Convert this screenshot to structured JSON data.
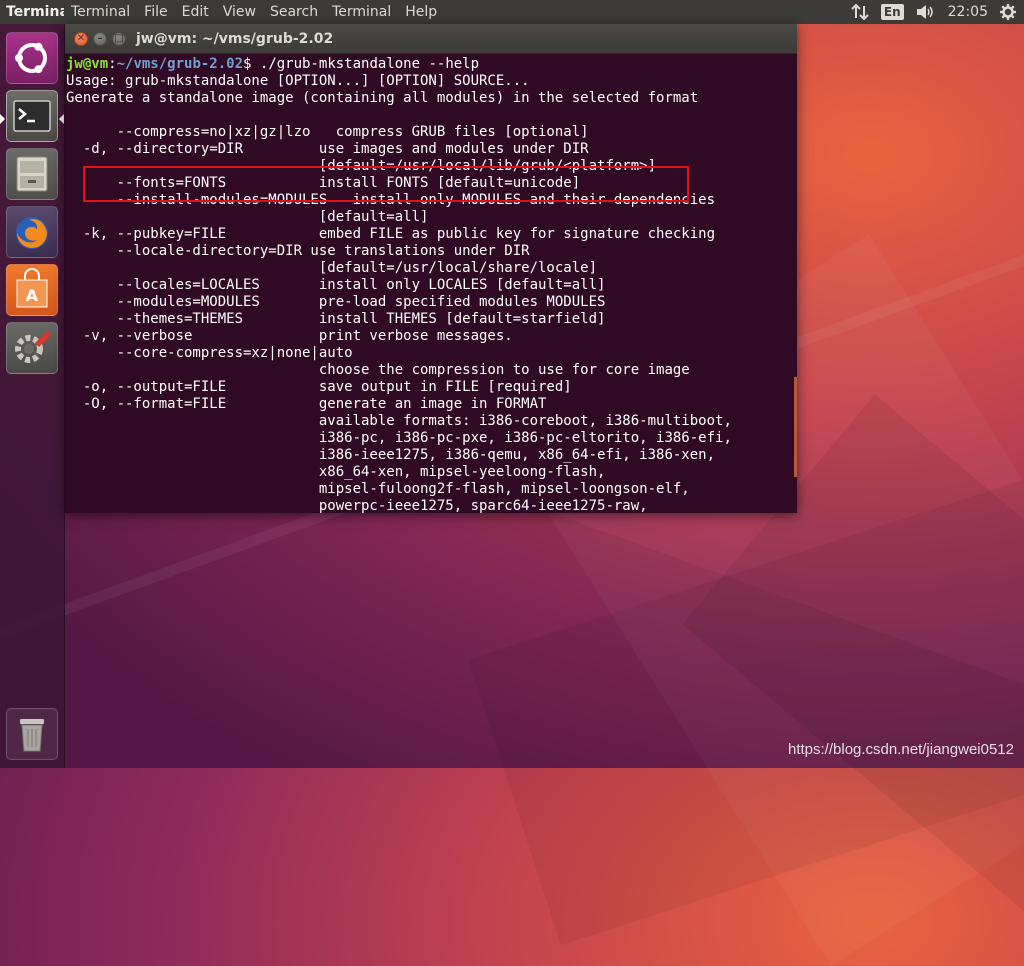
{
  "top_panel": {
    "app_name": "Terminal",
    "menu": [
      "Terminal",
      "File",
      "Edit",
      "View",
      "Search",
      "Terminal",
      "Help"
    ],
    "keyboard_layout": "En",
    "clock": "22:05"
  },
  "launcher": {
    "items": [
      "ubuntu-dash",
      "terminal",
      "files",
      "firefox",
      "software-center",
      "system-settings",
      "trash"
    ]
  },
  "window": {
    "title": "jw@vm: ~/vms/grub-2.02"
  },
  "terminal": {
    "prompt_user": "jw@vm",
    "prompt_sep": ":",
    "prompt_path": "~/vms/grub-2.02",
    "prompt_cmd": "$ ./grub-mkstandalone --help",
    "lines": [
      "Usage: grub-mkstandalone [OPTION...] [OPTION] SOURCE...",
      "Generate a standalone image (containing all modules) in the selected format",
      "",
      "      --compress=no|xz|gz|lzo   compress GRUB files [optional]",
      "  -d, --directory=DIR         use images and modules under DIR",
      "                              [default=/usr/local/lib/grub/<platform>]",
      "      --fonts=FONTS           install FONTS [default=unicode]",
      "      --install-modules=MODULES   install only MODULES and their dependencies",
      "                              [default=all]",
      "  -k, --pubkey=FILE           embed FILE as public key for signature checking",
      "      --locale-directory=DIR use translations under DIR",
      "                              [default=/usr/local/share/locale]",
      "      --locales=LOCALES       install only LOCALES [default=all]",
      "      --modules=MODULES       pre-load specified modules MODULES",
      "      --themes=THEMES         install THEMES [default=starfield]",
      "  -v, --verbose               print verbose messages.",
      "      --core-compress=xz|none|auto",
      "                              choose the compression to use for core image",
      "  -o, --output=FILE           save output in FILE [required]",
      "  -O, --format=FILE           generate an image in FORMAT",
      "                              available formats: i386-coreboot, i386-multiboot,",
      "                              i386-pc, i386-pc-pxe, i386-pc-eltorito, i386-efi,",
      "                              i386-ieee1275, i386-qemu, x86_64-efi, i386-xen,",
      "                              x86_64-xen, mipsel-yeeloong-flash,",
      "                              mipsel-fuloong2f-flash, mipsel-loongson-elf,",
      "                              powerpc-ieee1275, sparc64-ieee1275-raw,"
    ]
  },
  "watermark": "https://blog.csdn.net/jiangwei0512"
}
